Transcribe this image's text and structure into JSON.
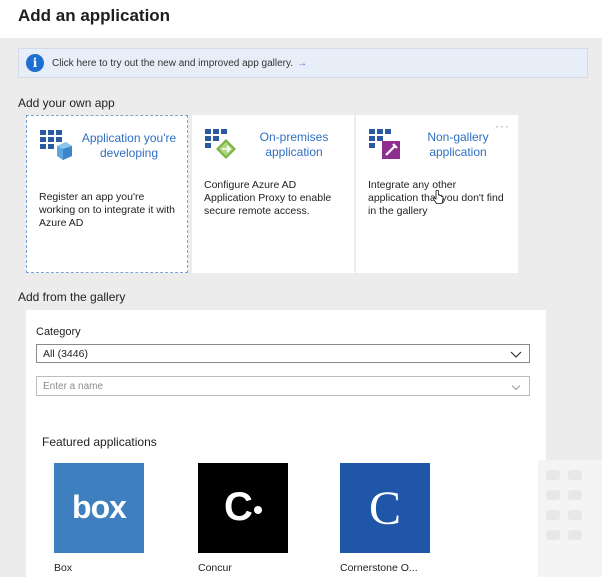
{
  "page": {
    "title": "Add an application"
  },
  "banner": {
    "text": "Click here to try out the new and improved app gallery.",
    "arrow": "→",
    "icon": "info-icon",
    "icon_glyph": "i"
  },
  "own_app": {
    "heading": "Add your own app",
    "cards": [
      {
        "title": "Application you're developing",
        "description": "Register an app you're working on to integrate it with Azure AD",
        "icon": "app-developing-icon"
      },
      {
        "title": "On-premises application",
        "description": "Configure Azure AD Application Proxy to enable secure remote access.",
        "icon": "on-premises-icon"
      },
      {
        "title": "Non-gallery application",
        "description": "Integrate any other application that you don't find in the gallery",
        "icon": "non-gallery-icon",
        "more": "···"
      }
    ]
  },
  "gallery": {
    "heading": "Add from the gallery",
    "category_label": "Category",
    "category_value": "All (3446)",
    "search_placeholder": "Enter a name",
    "featured_title": "Featured applications",
    "apps": [
      {
        "name": "Box",
        "logo_text": "box",
        "color": "#3d7fbf"
      },
      {
        "name": "Concur",
        "logo_text": "C",
        "color": "#000000"
      },
      {
        "name": "Cornerstone O...",
        "logo_text": "C",
        "color": "#1f56a8"
      }
    ]
  },
  "colors": {
    "accent": "#2f6fc4",
    "info": "#1f6fd0",
    "box": "#3d7fbf",
    "concur": "#000000",
    "cornerstone": "#1f56a8"
  }
}
